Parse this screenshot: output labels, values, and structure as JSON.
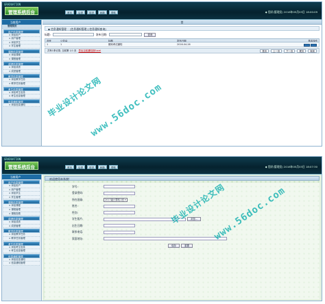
{
  "screen1": {
    "brand": "GRADUATION",
    "app_title": "管理系统后台",
    "nav": [
      "首页",
      "后退",
      "前进",
      "刷新",
      "帮助"
    ],
    "user_info": "◆ 您好(管理员) 2016年05月03日 18:00:09",
    "side_header": "当前用户",
    "side_title": "管理首页",
    "groups": [
      {
        "title": "用户信息管理",
        "items": [
          "添加用户",
          "用户管理",
          "添加学生",
          "学生管理"
        ]
      },
      {
        "title": "课程信息管理",
        "items": [
          "添加课程",
          "课程管理"
        ]
      },
      {
        "title": "成绩信息管理",
        "items": [
          "添加成绩",
          "成绩管理"
        ]
      },
      {
        "title": "教学信息管理",
        "items": [
          "添加教学任务",
          "教学任务管理"
        ]
      },
      {
        "title": "考生信息管理",
        "items": [
          "添加考生信息",
          "考生信息管理"
        ]
      },
      {
        "title": "信息通知管理",
        "items": [
          "添加信息通知"
        ]
      }
    ],
    "main_header": "首",
    "tab_label": "◆ 信息通知管理 ：[信息通知管理] [信息通知查询]",
    "search": {
      "label1": "标题:",
      "label2": "发布日期:",
      "button": "查询"
    },
    "columns": [
      "选号",
      "公告ID",
      "标题",
      "发布日期",
      "基本操作"
    ],
    "rows": [
      [
        "1",
        "1",
        "期末考试通知",
        "2016-04-26",
        ""
      ]
    ],
    "pager": {
      "info": "共有1条记录, 当前第 1/1 页",
      "export": "导出当前通知到Excel",
      "buttons": [
        "首页",
        "上一页",
        "下一页",
        "尾页",
        "转到"
      ]
    }
  },
  "screen2": {
    "brand": "GRADUATION",
    "app_title": "管理系统后台",
    "nav": [
      "首页",
      "后退",
      "前进",
      "刷新",
      "帮助"
    ],
    "user_info": "◆ 您好(管理员) 2016年05月03日 18:07:30",
    "side_header": "当前用户",
    "groups": [
      {
        "title": "用户信息管理",
        "items": [
          "添加用户",
          "用户管理",
          "添加学生",
          "学生管理"
        ]
      },
      {
        "title": "课程信息管理",
        "items": [
          "添加课程",
          "课程管理",
          "课程查看"
        ]
      },
      {
        "title": "成绩信息管理",
        "items": [
          "添加成绩",
          "成绩管理"
        ]
      },
      {
        "title": "教学信息管理",
        "items": [
          "添加教学任务",
          "教学任务管理"
        ]
      },
      {
        "title": "考生信息管理",
        "items": [
          "添加考生信息",
          "考生信息管理"
        ]
      },
      {
        "title": "信息通知管理",
        "items": [
          "添加信息通知",
          "信息通知管理"
        ]
      }
    ],
    "welcome": "欢迎使用本系统!",
    "fields": [
      {
        "label": "学号:",
        "type": "input"
      },
      {
        "label": "登录密码:",
        "type": "input"
      },
      {
        "label": "所在班级:",
        "type": "select",
        "value": "2017级计算机1班"
      },
      {
        "label": "姓名:",
        "type": "input"
      },
      {
        "label": "性别:",
        "type": "input"
      },
      {
        "label": "学生照片:",
        "type": "file",
        "button": "浏览..."
      },
      {
        "label": "出生日期:",
        "type": "input"
      },
      {
        "label": "联系电话:",
        "type": "input"
      },
      {
        "label": "家庭地址:",
        "type": "wide"
      }
    ],
    "buttons": [
      "保存",
      "重置"
    ]
  },
  "watermarks": [
    "毕业设计论文网",
    "www.56doc.com"
  ]
}
